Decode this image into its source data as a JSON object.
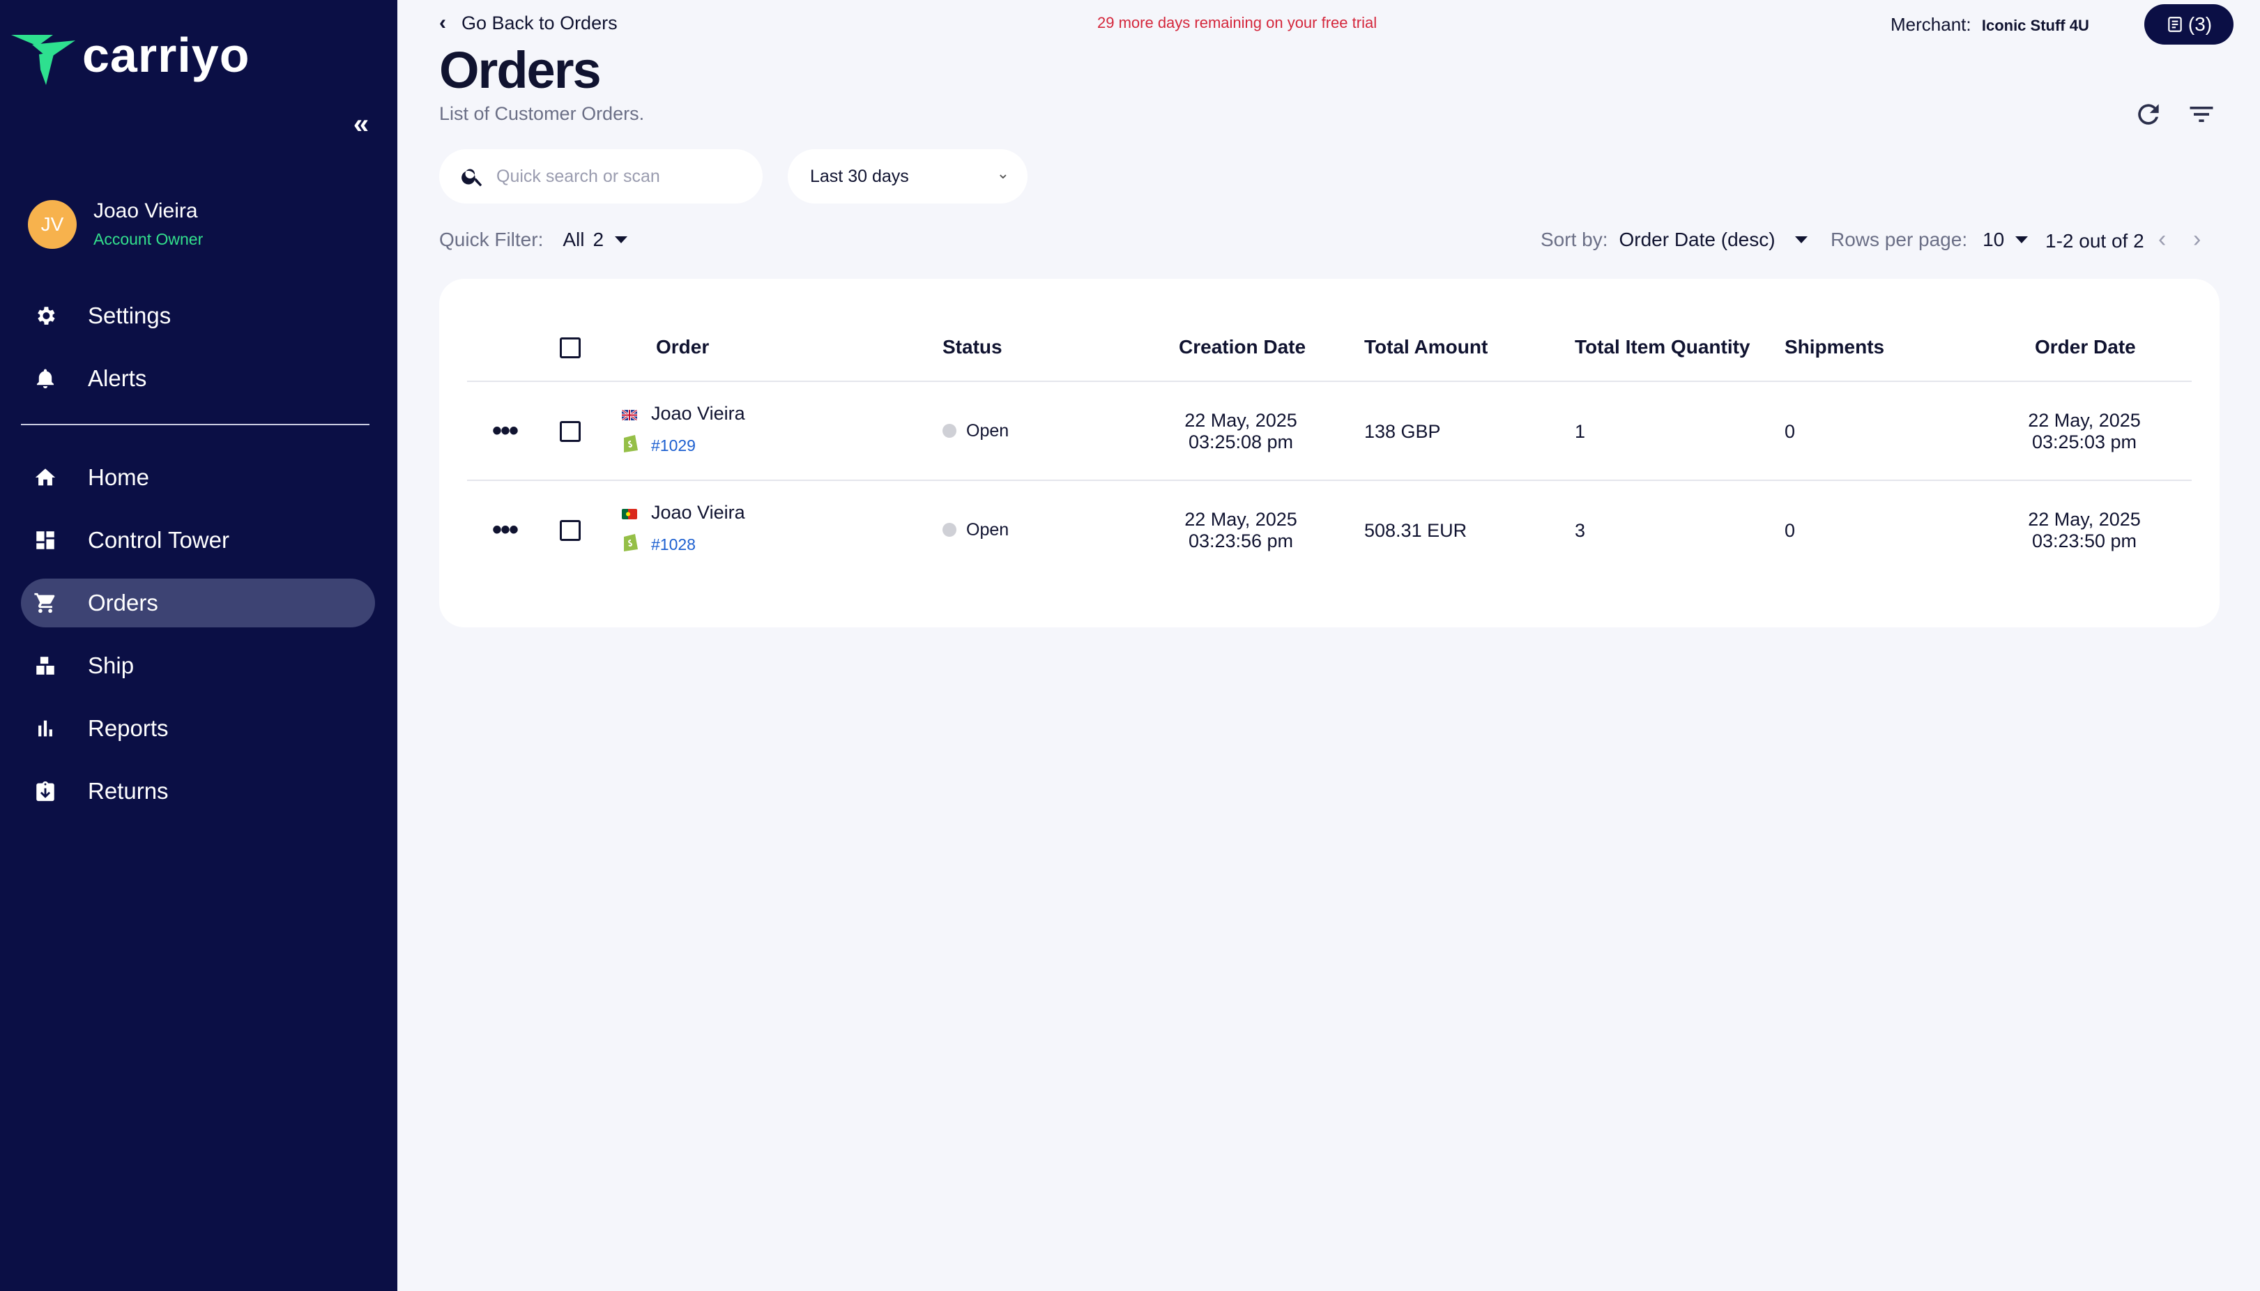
{
  "sidebar": {
    "logo_text": "carriyo",
    "user": {
      "initials": "JV",
      "name": "Joao Vieira",
      "role": "Account Owner"
    },
    "items_top": [
      {
        "label": "Settings",
        "icon": "gear-icon"
      },
      {
        "label": "Alerts",
        "icon": "bell-icon"
      }
    ],
    "items": [
      {
        "label": "Home",
        "icon": "home-icon"
      },
      {
        "label": "Control Tower",
        "icon": "dashboard-icon"
      },
      {
        "label": "Orders",
        "icon": "cart-icon",
        "active": true
      },
      {
        "label": "Ship",
        "icon": "boxes-icon"
      },
      {
        "label": "Reports",
        "icon": "bar-chart-icon"
      },
      {
        "label": "Returns",
        "icon": "return-icon"
      }
    ]
  },
  "header": {
    "back_label": "Go Back to Orders",
    "trial_notice": "29 more days remaining on your free trial",
    "merchant_label": "Merchant:",
    "merchant_name": "Iconic Stuff 4U",
    "queue_count": "(3)",
    "title": "Orders",
    "subtitle": "List of Customer Orders."
  },
  "toolbar": {
    "search_placeholder": "Quick search or scan",
    "date_range": "Last 30 days",
    "quick_filter_label": "Quick Filter:",
    "quick_filter_value": "All",
    "quick_filter_count": "2",
    "sort_label": "Sort by:",
    "sort_value": "Order Date (desc)",
    "rows_label": "Rows per page:",
    "rows_value": "10",
    "range": "1-2 out of 2"
  },
  "table": {
    "columns": [
      "Order",
      "Status",
      "Creation Date",
      "Total Amount",
      "Total Item Quantity",
      "Shipments",
      "Order Date"
    ],
    "rows": [
      {
        "customer": "Joao Vieira",
        "flag": "GB",
        "order_no": "#1029",
        "status": "Open",
        "creation_date": "22 May, 2025",
        "creation_time": "03:25:08 pm",
        "total_amount": "138 GBP",
        "quantity": "1",
        "shipments": "0",
        "order_date": "22 May, 2025",
        "order_time": "03:25:03 pm"
      },
      {
        "customer": "Joao Vieira",
        "flag": "PT",
        "order_no": "#1028",
        "status": "Open",
        "creation_date": "22 May, 2025",
        "creation_time": "03:23:56 pm",
        "total_amount": "508.31 EUR",
        "quantity": "3",
        "shipments": "0",
        "order_date": "22 May, 2025",
        "order_time": "03:23:50 pm"
      }
    ]
  },
  "colors": {
    "sidebar_bg": "#0b0f45",
    "accent_green": "#33e08d",
    "trial_red": "#d4263b",
    "link_blue": "#1c5fd0",
    "avatar_orange": "#f7b24d"
  }
}
